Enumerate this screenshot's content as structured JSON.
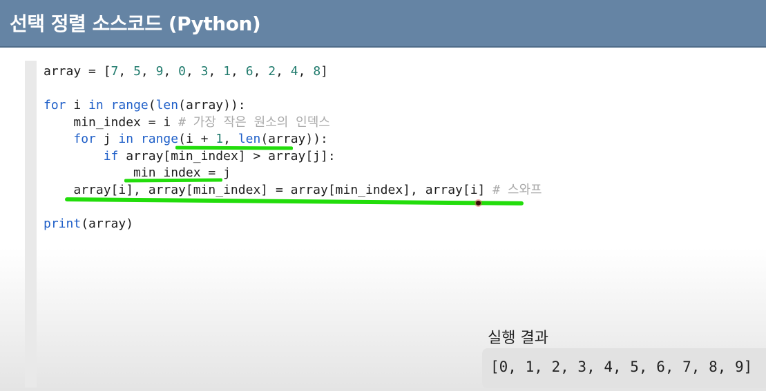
{
  "header": {
    "title": "선택 정렬 소스코드 (Python)"
  },
  "code": {
    "line1": {
      "name": "array",
      "assign": " = [",
      "numbers": [
        "7",
        "5",
        "9",
        "0",
        "3",
        "1",
        "6",
        "2",
        "4",
        "8"
      ],
      "close": "]"
    },
    "line3": {
      "for_kw": "for",
      "var": " i ",
      "in_kw": "in",
      "range_fn": "range",
      "open": "(",
      "len_fn": "len",
      "rest": "(array)):"
    },
    "line4": {
      "code": "min_index = i ",
      "comment": "# 가장 작은 원소의 인덱스"
    },
    "line5": {
      "for_kw": "for",
      "var": " j ",
      "in_kw": "in",
      "range_fn": "range",
      "open": "(i + ",
      "one": "1",
      "comma": ", ",
      "len_fn": "len",
      "rest": "(array)):"
    },
    "line6": {
      "if_kw": "if",
      "rest": " array[min_index] > array[j]:"
    },
    "line7": {
      "code": "min_index = j"
    },
    "line8": {
      "code": "array[i], array[min_index] = array[min_index], array[i] ",
      "comment": "# 스와프"
    },
    "line10": {
      "print_fn": "print",
      "rest": "(array)"
    }
  },
  "result": {
    "label": "실행 결과",
    "value": "[0, 1, 2, 3, 4, 5, 6, 7, 8, 9]"
  },
  "colors": {
    "header_bg": "#6584a4",
    "keyword": "#1f5fc8",
    "number": "#1f7a6c",
    "comment": "#a9a9a9",
    "highlight": "#22dd0b",
    "result_bg": "#e2e2e2"
  }
}
